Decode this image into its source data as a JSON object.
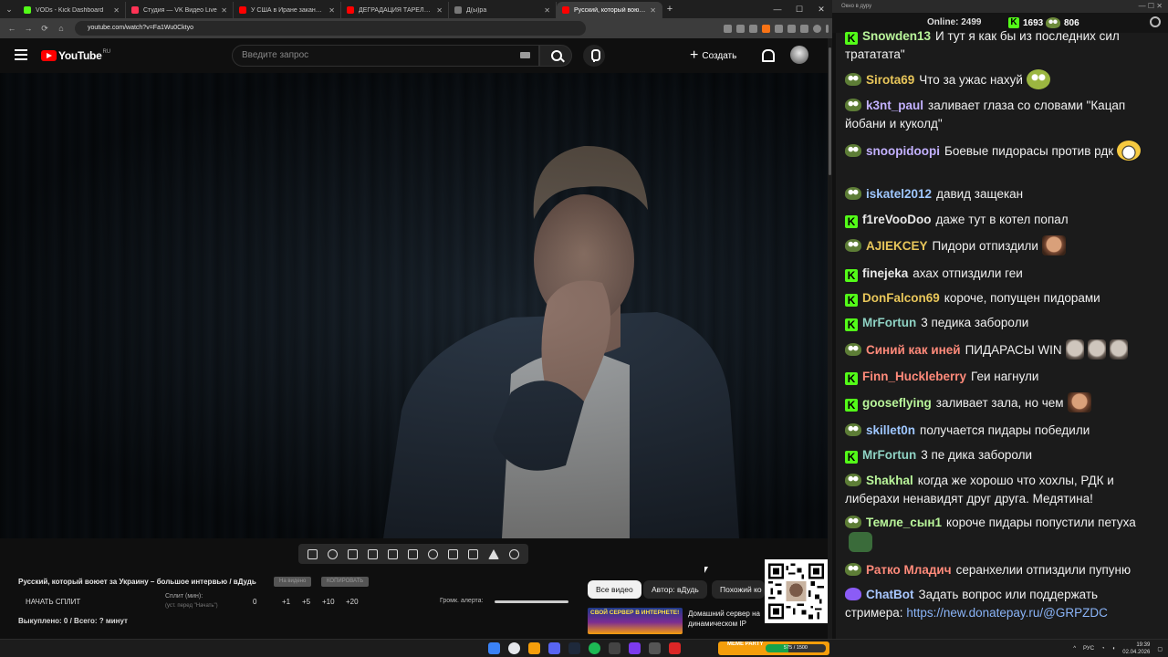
{
  "browser": {
    "tabs": [
      {
        "title": "VODs - Kick Dashboard",
        "color": "#53fc18"
      },
      {
        "title": "Студия — VK Видео Live",
        "color": "#ff3355"
      },
      {
        "title": "У США в Иране заканчиваются",
        "color": "#ff0000"
      },
      {
        "title": "ДЕГРАДАЦИЯ ТАРЕЛОЧНИЦ",
        "color": "#ff0000"
      },
      {
        "title": "Д(ы)ра",
        "color": "#777777"
      },
      {
        "title": "Русский, который воюет за",
        "color": "#ff0000"
      }
    ],
    "url": "youtube.com/watch?v=Fa1Wu0Cktyo"
  },
  "youtube": {
    "logo_text": "YouTube",
    "logo_region": "RU",
    "search_placeholder": "Введите запрос",
    "create_label": "Создать"
  },
  "plugin": {
    "video_title": "Русский, который воюет за Украину – большое интервью / вДудь",
    "btn_on_video": "На видено",
    "btn_copy": "КОПИРОВАТЬ",
    "start_split": "НАЧАТЬ СПЛИТ",
    "split_label": "Сплит (мин):",
    "split_sub": "(уст. перед \"Начать\")",
    "split_values": [
      "0",
      "+1",
      "+5",
      "+10",
      "+20"
    ],
    "alert_label": "Громк. алерта:",
    "bought": "Выкуплено: 0 / Всего: ? минут"
  },
  "chips": [
    "Все видео",
    "Автор: вДудь",
    "Похожий ко"
  ],
  "recommended": {
    "thumb_text": "СВОЙ СЕРВЕР В ИНТЕРНЕТЕ!",
    "title": "Домашний сервер на динамическом IP бесплатно!..."
  },
  "chat": {
    "window_title": "Окно в дуру",
    "online_label": "Online:",
    "online_count": "2499",
    "kick_count": "1693",
    "other_count": "806",
    "messages": [
      {
        "badge": "kick",
        "user": "Snowden13",
        "color": "#b9f59a",
        "text": "И тут я как бы из последних сил трататата\"",
        "emotes": []
      },
      {
        "badge": "pepe",
        "user": "Sirota69",
        "color": "#e8c65a",
        "text": "Что за ужас нахуй",
        "emotes": [
          "pepe"
        ]
      },
      {
        "badge": "pepe",
        "user": "k3nt_paul",
        "color": "#c3b1ff",
        "text": "заливает глаза со словами \"Кацап йобани и куколд\"",
        "emotes": []
      },
      {
        "badge": "pepe",
        "user": "snoopidoopi",
        "color": "#c3b1ff",
        "text": "Боевые пидорасы против рдк",
        "emotes": [
          "grin"
        ]
      },
      {
        "badge": "pepe",
        "user": "iskatel2012",
        "color": "#9fc7ff",
        "text": "давид защекан",
        "emotes": []
      },
      {
        "badge": "kick",
        "user": "f1reVooDoo",
        "color": "#e8e8e8",
        "text": "даже тут в котел попал",
        "emotes": []
      },
      {
        "badge": "pepe",
        "user": "AJIEKCEY",
        "color": "#e8c65a",
        "text": "Пидори отпиздили",
        "emotes": [
          "face"
        ]
      },
      {
        "badge": "kick",
        "user": "finejeka",
        "color": "#e8e8e8",
        "text": "ахах отпиздили геи",
        "emotes": []
      },
      {
        "badge": "kick",
        "user": "DonFalcon69",
        "color": "#e8c65a",
        "text": "короче, попущен пидорами",
        "emotes": []
      },
      {
        "badge": "kick",
        "user": "MrFortun",
        "color": "#8fd3c4",
        "text": "3 педика заборoли",
        "emotes": []
      },
      {
        "badge": "pepe",
        "user": "Синий как иней",
        "color": "#ff8a7a",
        "text": "ПИДАРАСЫ WIN",
        "emotes": [
          "bald",
          "bald",
          "bald"
        ]
      },
      {
        "badge": "kick",
        "user": "Finn_Huckleberry",
        "color": "#ff8a7a",
        "text": "Геи нагнули",
        "emotes": []
      },
      {
        "badge": "kick",
        "user": "gooseflying",
        "color": "#b9f59a",
        "text": "заливает зала, но чем",
        "emotes": [
          "face"
        ]
      },
      {
        "badge": "pepe",
        "user": "skillet0n",
        "color": "#9fc7ff",
        "text": "получается пидары победили",
        "emotes": []
      },
      {
        "badge": "kick",
        "user": "MrFortun",
        "color": "#8fd3c4",
        "text": "3 пе дика забoроли",
        "emotes": []
      },
      {
        "badge": "pepe",
        "user": "Shakhal",
        "color": "#b9f59a",
        "text": "когда же хорошо что хохлы, РДК и либерахи ненавидят друг друга. Медятина!",
        "emotes": []
      },
      {
        "badge": "pepe",
        "user": "Темле_сын1",
        "color": "#b9f59a",
        "text": "короче пидары попустили петуха",
        "emotes": [
          "frog"
        ]
      },
      {
        "badge": "pepe",
        "user": "Ратко Младич",
        "color": "#ff8a7a",
        "text": "серанхелии отпиздили пупуню",
        "emotes": []
      },
      {
        "badge": "bot",
        "user": "ChatBot",
        "color": "#a8c7ff",
        "text": "Задать вопрос или поддержать стримера:",
        "link": "https://new.donatepay.ru/@GRPZDC",
        "emotes": []
      }
    ]
  },
  "taskbar": {
    "widget_text": "MEME PARTY",
    "widget_progress": "575 / 1500",
    "widget_fill": 0.38,
    "lang": "РУС",
    "time": "19:39",
    "date": "02.04.2026"
  }
}
